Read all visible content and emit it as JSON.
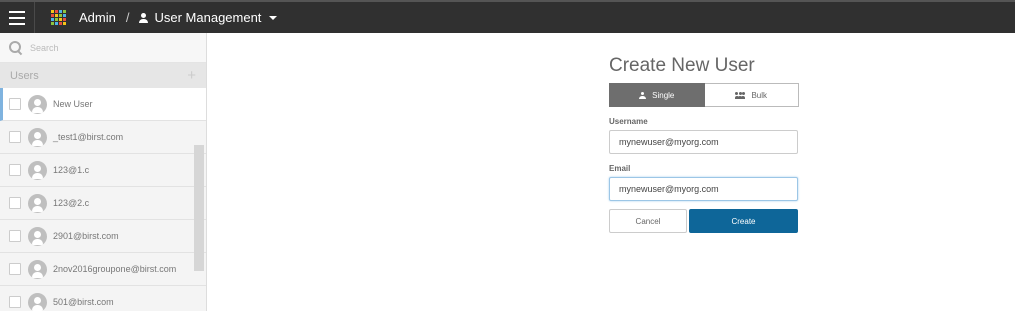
{
  "header": {
    "breadcrumb_admin": "Admin",
    "breadcrumb_separator": "/",
    "breadcrumb_section": "User Management"
  },
  "sidebar": {
    "search_placeholder": "Search",
    "users_header": "Users",
    "add_symbol": "+",
    "items": [
      {
        "label": "New User",
        "selected": true
      },
      {
        "label": "_test1@birst.com",
        "selected": false
      },
      {
        "label": "123@1.c",
        "selected": false
      },
      {
        "label": "123@2.c",
        "selected": false
      },
      {
        "label": "2901@birst.com",
        "selected": false
      },
      {
        "label": "2nov2016groupone@birst.com",
        "selected": false
      },
      {
        "label": "501@birst.com",
        "selected": false
      }
    ]
  },
  "form": {
    "title": "Create New User",
    "toggle_single": "Single",
    "toggle_bulk": "Bulk",
    "username_label": "Username",
    "username_value": "mynewuser@myorg.com",
    "email_label": "Email",
    "email_value": "mynewuser@myorg.com",
    "cancel_label": "Cancel",
    "create_label": "Create"
  },
  "colors": {
    "topbar": "#303030",
    "accent": "#0e6699",
    "toggle_active": "#6e6e6e",
    "selected_indicator": "#7fb3df"
  }
}
